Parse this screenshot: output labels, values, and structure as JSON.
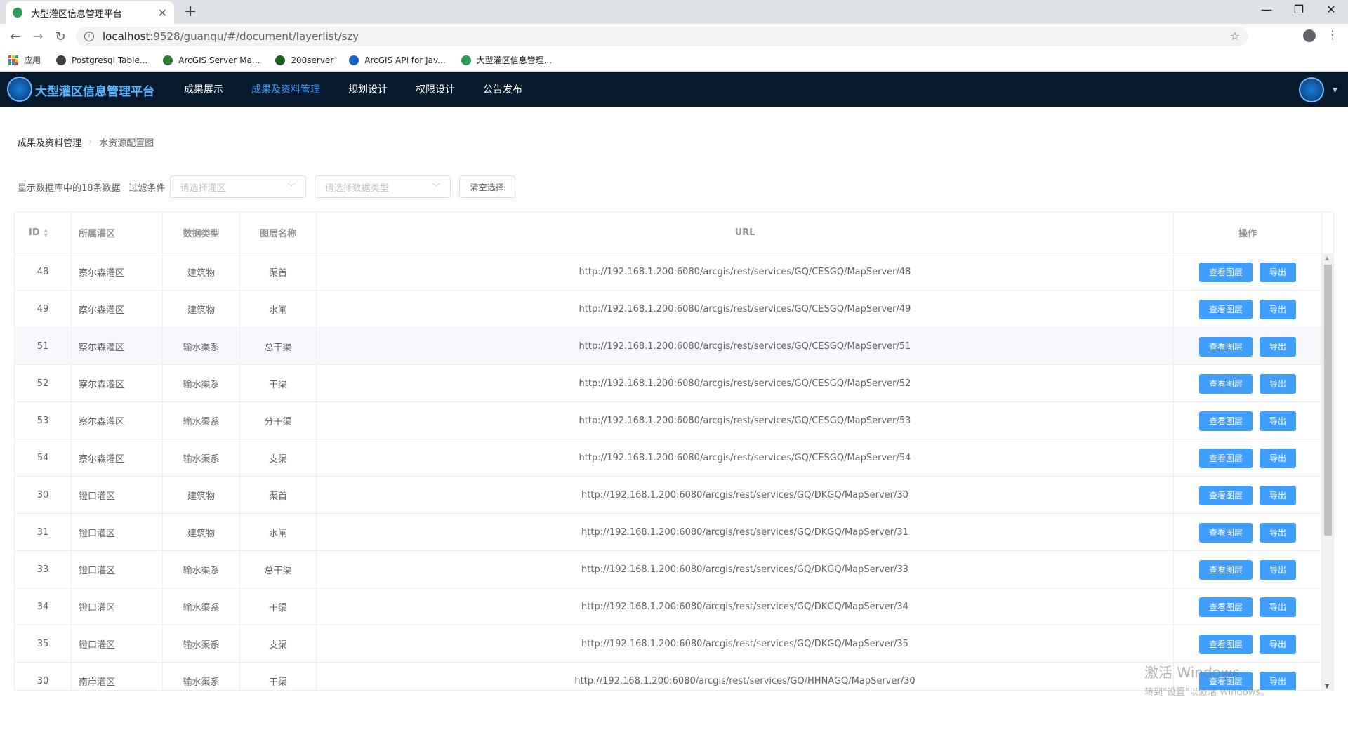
{
  "browser": {
    "tab_title": "大型灌区信息管理平台",
    "url_host": "localhost",
    "url_path": ":9528/guanqu/#/document/layerlist/szy",
    "bookmarks": [
      {
        "label": "应用",
        "color": "#e8453c"
      },
      {
        "label": "Postgresql Table...",
        "color": "#3c4043"
      },
      {
        "label": "ArcGIS Server Ma...",
        "color": "#2e7d32"
      },
      {
        "label": "200server",
        "color": "#1b5e20"
      },
      {
        "label": "ArcGIS API for Jav...",
        "color": "#1565c0"
      },
      {
        "label": "大型灌区信息管理...",
        "color": "#2e9a5a"
      }
    ]
  },
  "header": {
    "brand": "大型灌区信息管理平台",
    "nav": [
      {
        "label": "成果展示",
        "active": false
      },
      {
        "label": "成果及资料管理",
        "active": true
      },
      {
        "label": "规划设计",
        "active": false
      },
      {
        "label": "权限设计",
        "active": false
      },
      {
        "label": "公告发布",
        "active": false
      }
    ]
  },
  "breadcrumb": {
    "parent": "成果及资料管理",
    "current": "水资源配置图"
  },
  "filter": {
    "count_text": "显示数据库中的18条数据",
    "label": "过滤条件",
    "district_placeholder": "请选择灌区",
    "type_placeholder": "请选择数据类型",
    "clear_label": "清空选择"
  },
  "table": {
    "columns": {
      "id": "ID",
      "district": "所属灌区",
      "type": "数据类型",
      "layer": "图层名称",
      "url": "URL",
      "ops": "操作"
    },
    "view_label": "查看图层",
    "export_label": "导出",
    "rows": [
      {
        "id": "48",
        "district": "察尔森灌区",
        "type": "建筑物",
        "layer": "渠首",
        "url": "http://192.168.1.200:6080/arcgis/rest/services/GQ/CESGQ/MapServer/48"
      },
      {
        "id": "49",
        "district": "察尔森灌区",
        "type": "建筑物",
        "layer": "水闸",
        "url": "http://192.168.1.200:6080/arcgis/rest/services/GQ/CESGQ/MapServer/49"
      },
      {
        "id": "51",
        "district": "察尔森灌区",
        "type": "输水渠系",
        "layer": "总干渠",
        "url": "http://192.168.1.200:6080/arcgis/rest/services/GQ/CESGQ/MapServer/51"
      },
      {
        "id": "52",
        "district": "察尔森灌区",
        "type": "输水渠系",
        "layer": "干渠",
        "url": "http://192.168.1.200:6080/arcgis/rest/services/GQ/CESGQ/MapServer/52"
      },
      {
        "id": "53",
        "district": "察尔森灌区",
        "type": "输水渠系",
        "layer": "分干渠",
        "url": "http://192.168.1.200:6080/arcgis/rest/services/GQ/CESGQ/MapServer/53"
      },
      {
        "id": "54",
        "district": "察尔森灌区",
        "type": "输水渠系",
        "layer": "支渠",
        "url": "http://192.168.1.200:6080/arcgis/rest/services/GQ/CESGQ/MapServer/54"
      },
      {
        "id": "30",
        "district": "镫口灌区",
        "type": "建筑物",
        "layer": "渠首",
        "url": "http://192.168.1.200:6080/arcgis/rest/services/GQ/DKGQ/MapServer/30"
      },
      {
        "id": "31",
        "district": "镫口灌区",
        "type": "建筑物",
        "layer": "水闸",
        "url": "http://192.168.1.200:6080/arcgis/rest/services/GQ/DKGQ/MapServer/31"
      },
      {
        "id": "33",
        "district": "镫口灌区",
        "type": "输水渠系",
        "layer": "总干渠",
        "url": "http://192.168.1.200:6080/arcgis/rest/services/GQ/DKGQ/MapServer/33"
      },
      {
        "id": "34",
        "district": "镫口灌区",
        "type": "输水渠系",
        "layer": "干渠",
        "url": "http://192.168.1.200:6080/arcgis/rest/services/GQ/DKGQ/MapServer/34"
      },
      {
        "id": "35",
        "district": "镫口灌区",
        "type": "输水渠系",
        "layer": "支渠",
        "url": "http://192.168.1.200:6080/arcgis/rest/services/GQ/DKGQ/MapServer/35"
      },
      {
        "id": "30",
        "district": "南岸灌区",
        "type": "输水渠系",
        "layer": "干渠",
        "url": "http://192.168.1.200:6080/arcgis/rest/services/GQ/HHNAGQ/MapServer/30"
      }
    ],
    "hover_row": 2
  },
  "watermark": {
    "line1": "激活 Windows",
    "line2": "转到\"设置\"以激活 Windows。"
  }
}
